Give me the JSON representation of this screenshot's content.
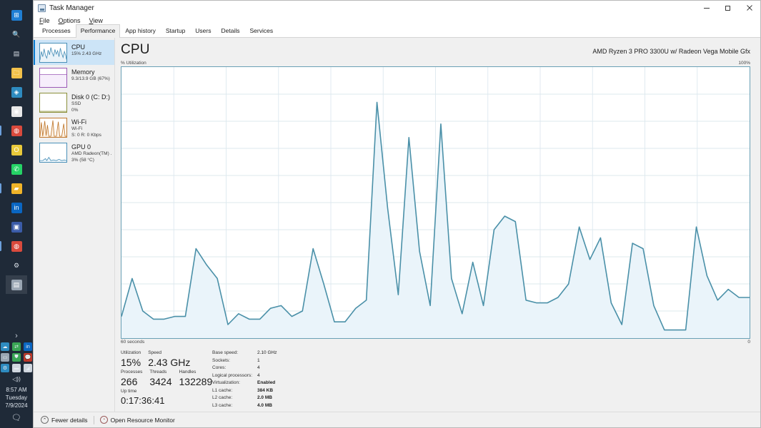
{
  "taskbar": {
    "icons": [
      {
        "name": "start-icon",
        "glyph": "⊞",
        "color": "#1f7fd4",
        "running": false
      },
      {
        "name": "search-icon",
        "glyph": "🔍",
        "color": "transparent",
        "running": false
      },
      {
        "name": "task-view-icon",
        "glyph": "▤",
        "color": "transparent",
        "running": false
      },
      {
        "name": "file-explorer-icon",
        "glyph": "🗀",
        "color": "#f2c14a",
        "running": false
      },
      {
        "name": "microsoft-store-icon",
        "glyph": "◈",
        "color": "#2e8bc0",
        "running": false
      },
      {
        "name": "firefox-icon",
        "glyph": "◉",
        "color": "#e8e8e8",
        "running": false
      },
      {
        "name": "chrome-icon",
        "glyph": "◍",
        "color": "#d94a3d",
        "running": true
      },
      {
        "name": "opera-icon",
        "glyph": "O",
        "color": "#e8c93a",
        "running": false
      },
      {
        "name": "whatsapp-icon",
        "glyph": "✆",
        "color": "#25d366",
        "running": false
      },
      {
        "name": "folder-app-icon",
        "glyph": "▰",
        "color": "#f0b429",
        "running": true
      },
      {
        "name": "linkedin-icon",
        "glyph": "in",
        "color": "#0a66c2",
        "running": false
      },
      {
        "name": "blue-app-icon",
        "glyph": "▣",
        "color": "#3b5ca8",
        "running": false
      },
      {
        "name": "chrome-second-icon",
        "glyph": "◍",
        "color": "#d94a3d",
        "running": true
      },
      {
        "name": "settings-gear-icon",
        "glyph": "⚙",
        "color": "transparent",
        "running": false
      },
      {
        "name": "task-manager-taskbar-icon",
        "glyph": "▤",
        "color": "#9aa6b3",
        "running": false,
        "active": true
      }
    ],
    "tray": {
      "chevron": "›",
      "row1": [
        {
          "name": "onedrive-tray-icon",
          "glyph": "☁",
          "color": "#2e8bc0"
        },
        {
          "name": "sync-tray-icon",
          "glyph": "⇄",
          "color": "#3aa655"
        },
        {
          "name": "linkedin-tray-icon",
          "glyph": "in",
          "color": "#0a66c2"
        }
      ],
      "row2": [
        {
          "name": "display-tray-icon",
          "glyph": "▭",
          "color": "#9aa6b3"
        },
        {
          "name": "shield-tray-icon",
          "glyph": "⛊",
          "color": "#3aa655"
        },
        {
          "name": "chat-tray-icon",
          "glyph": "💬",
          "color": "#c0392b"
        }
      ],
      "row3": [
        {
          "name": "settings-tray-icon",
          "glyph": "⚙",
          "color": "#2e8bc0"
        },
        {
          "name": "battery-tray-icon",
          "glyph": "▬",
          "color": "#cfd6de"
        },
        {
          "name": "wifi-tray-icon",
          "glyph": "◢",
          "color": "#cfd6de"
        }
      ],
      "volume": {
        "name": "volume-tray-icon",
        "glyph": "◁))"
      },
      "clock": {
        "time": "8:57 AM",
        "day": "Tuesday",
        "date": "7/9/2024"
      },
      "notifications": {
        "name": "action-center-icon",
        "glyph": "🗨"
      }
    }
  },
  "window": {
    "title": "Task Manager",
    "controls": {
      "minimize": "minimize-button",
      "restore": "restore-button",
      "close": "close-button"
    }
  },
  "menu": {
    "items": [
      {
        "label": "File",
        "accel": "F"
      },
      {
        "label": "Options",
        "accel": "O"
      },
      {
        "label": "View",
        "accel": "V"
      }
    ]
  },
  "tabs": {
    "items": [
      "Processes",
      "Performance",
      "App history",
      "Startup",
      "Users",
      "Details",
      "Services"
    ],
    "selected": "Performance"
  },
  "sidebar": {
    "items": [
      {
        "name": "CPU",
        "lines": [
          "15%  2.43 GHz"
        ],
        "selected": true,
        "color": "#4a90b8",
        "fill": "#eaf3f9",
        "spark": "0,25 2,12 4,20 6,8 8,18 10,22 12,10 14,17 16,6 18,14 20,19 22,9 24,16 26,11 28,20 30,7 32,15 34,21 36,12 38,18 39,24"
      },
      {
        "name": "Memory",
        "lines": [
          "9.3/13.9 GB (67%)"
        ],
        "selected": false,
        "color": "#9b59b6",
        "fill": "#f6eefb",
        "spark": "0,9 8,9 16,9 24,9 32,9 39,9"
      },
      {
        "name": "Disk 0 (C: D:)",
        "lines": [
          "SSD",
          "0%"
        ],
        "selected": false,
        "color": "#8a8f3a",
        "fill": "#fbfbf0",
        "spark": "0,27 10,27 20,27 30,27 39,27"
      },
      {
        "name": "Wi-Fi",
        "lines": [
          "Wi-Fi",
          "S: 0  R: 0 Kbps"
        ],
        "selected": false,
        "color": "#c0792f",
        "fill": "#fdf1e3",
        "spark": "0,27 2,6 4,27 7,4 9,26 11,10 13,27 16,27 19,3 21,27 24,27 27,5 29,27 32,27 35,8 37,27 39,27"
      },
      {
        "name": "GPU 0",
        "lines": [
          "AMD Radeon(TM) ...",
          "3% (58 °C)"
        ],
        "selected": false,
        "color": "#4a90b8",
        "fill": "#eef6fb",
        "spark": "0,26 4,26 8,23 10,26 13,21 16,26 20,25 24,26 28,24 32,26 36,25 39,26"
      }
    ]
  },
  "main": {
    "title": "CPU",
    "processor": "AMD Ryzen 3 PRO 3300U w/ Radeon Vega Mobile Gfx",
    "axis": {
      "y_label": "% Utilization",
      "y_max": "100%",
      "y_min": "0",
      "x_label": "60 seconds"
    },
    "graph_colors": {
      "line": "#4a90a8",
      "fill": "#eaf4fa",
      "grid": "#dce8ee",
      "border": "#6aa0b5"
    }
  },
  "chart_data": {
    "type": "area",
    "title": "CPU % Utilization",
    "xlabel": "60 seconds",
    "ylabel": "% Utilization",
    "ylim": [
      0,
      100
    ],
    "grid": true,
    "values": [
      8,
      22,
      10,
      7,
      7,
      8,
      8,
      33,
      27,
      22,
      5,
      9,
      7,
      7,
      11,
      12,
      8,
      10,
      33,
      20,
      6,
      6,
      11,
      14,
      87,
      48,
      16,
      74,
      32,
      12,
      79,
      22,
      9,
      28,
      12,
      40,
      45,
      43,
      14,
      13,
      13,
      15,
      20,
      41,
      29,
      37,
      13,
      5,
      35,
      33,
      12,
      3,
      3,
      3,
      41,
      23,
      14,
      18,
      15,
      15
    ]
  },
  "stats": {
    "left": [
      {
        "label": "Utilization",
        "value": "15%"
      },
      {
        "label": "Speed",
        "value": "2.43 GHz"
      },
      {
        "label": "Processes",
        "value": "266"
      },
      {
        "label": "Threads",
        "value": "3424"
      },
      {
        "label": "Handles",
        "value": "132289"
      },
      {
        "label": "Up time",
        "value": "0:17:36:41"
      }
    ],
    "right": [
      {
        "label": "Base speed:",
        "value": "2.10 GHz",
        "bold": false
      },
      {
        "label": "Sockets:",
        "value": "1",
        "bold": false
      },
      {
        "label": "Cores:",
        "value": "4",
        "bold": false
      },
      {
        "label": "Logical processors:",
        "value": "4",
        "bold": false
      },
      {
        "label": "Virtualization:",
        "value": "Enabled",
        "bold": true
      },
      {
        "label": "L1 cache:",
        "value": "384 KB",
        "bold": true
      },
      {
        "label": "L2 cache:",
        "value": "2.0 MB",
        "bold": true
      },
      {
        "label": "L3 cache:",
        "value": "4.0 MB",
        "bold": true
      }
    ]
  },
  "footer": {
    "fewer_details": "Fewer details",
    "fewer_icon": "⌃",
    "resource_monitor": "Open Resource Monitor",
    "resource_icon": "◔"
  }
}
